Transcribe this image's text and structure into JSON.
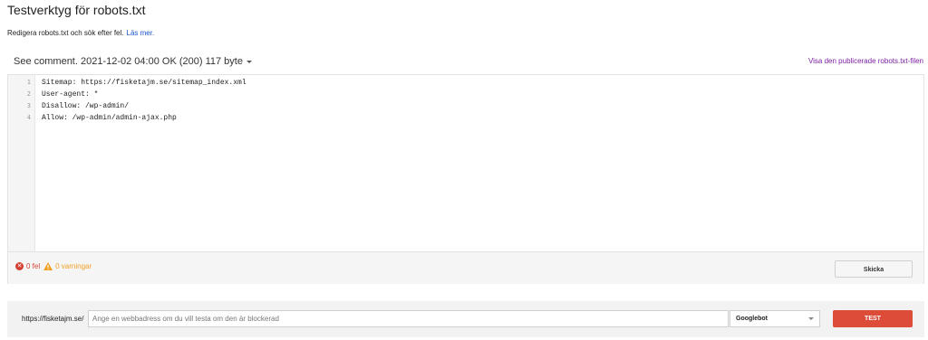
{
  "page": {
    "title": "Testverktyg för robots.txt",
    "subtitle": "Redigera robots.txt och sök efter fel.",
    "learn_more": "Läs mer."
  },
  "version": {
    "label": "See comment. 2021-12-02 04:00 OK (200) 117 byte"
  },
  "view_published_link": "Visa den publicerade robots.txt-filen",
  "editor": {
    "lines": [
      {
        "num": "1",
        "text": "Sitemap: https://fisketajm.se/sitemap_index.xml"
      },
      {
        "num": "2",
        "text": "User-agent: *"
      },
      {
        "num": "3",
        "text": "Disallow: /wp-admin/"
      },
      {
        "num": "4",
        "text": "Allow: /wp-admin/admin-ajax.php"
      }
    ]
  },
  "status": {
    "errors": "0 fel",
    "warnings": "0 varningar",
    "error_color": "#d23f31",
    "warning_color": "#f2a022",
    "submit_label": "Skicka"
  },
  "test": {
    "url_prefix": "https://fisketajm.se/",
    "placeholder": "Ange en webbadress om du vill testa om den är blockerad",
    "selected_bot": "Googlebot",
    "test_label": "TEST",
    "test_color": "#dd4b39"
  },
  "icons": {
    "error": "error-circle-icon",
    "warning": "warning-triangle-icon",
    "dropdown": "chevron-down-icon"
  }
}
